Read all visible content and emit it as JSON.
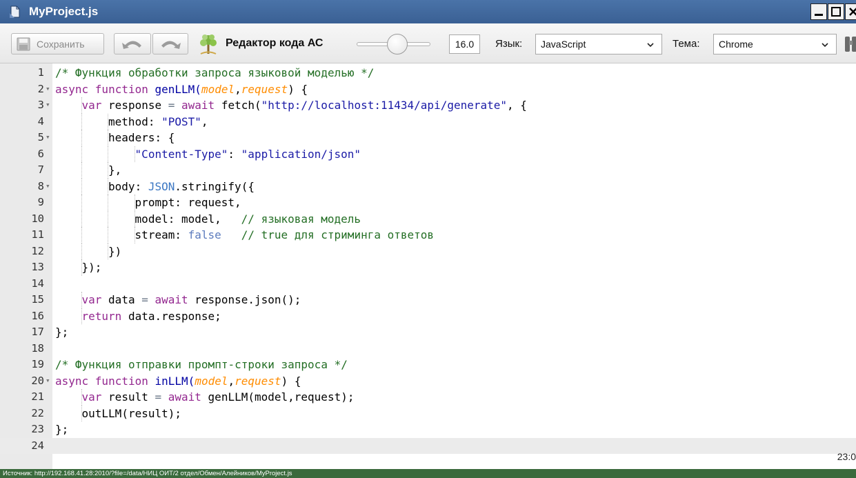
{
  "window": {
    "title": "MyProject.js",
    "icon": "document-icon"
  },
  "toolbar": {
    "save_label": "Сохранить",
    "brand_label": "Редактор кода АС",
    "font_size": "16.0",
    "language_label": "Язык:",
    "language_value": "JavaScript",
    "theme_label": "Тема:",
    "theme_value": "Chrome"
  },
  "editor": {
    "cursor_position": "23:0",
    "lines": [
      {
        "n": "1",
        "fold": "",
        "indent": 0,
        "tokens": [
          {
            "t": "/* Функция обработки запроса языковой моделью */",
            "c": "comment"
          }
        ]
      },
      {
        "n": "2",
        "fold": "▾",
        "indent": 0,
        "tokens": [
          {
            "t": "async ",
            "c": "kw"
          },
          {
            "t": "function ",
            "c": "kw"
          },
          {
            "t": "genLLM",
            "c": "fn"
          },
          {
            "t": "(",
            "c": "fn"
          },
          {
            "t": "model",
            "c": "param"
          },
          {
            "t": ",",
            "c": "def"
          },
          {
            "t": "request",
            "c": "param"
          },
          {
            "t": ") {",
            "c": "def"
          }
        ]
      },
      {
        "n": "3",
        "fold": "▾",
        "indent": 1,
        "tokens": [
          {
            "t": "var ",
            "c": "kw"
          },
          {
            "t": "response ",
            "c": "def"
          },
          {
            "t": "= ",
            "c": "op"
          },
          {
            "t": "await ",
            "c": "kw"
          },
          {
            "t": "fetch(",
            "c": "def"
          },
          {
            "t": "\"http://localhost:11434/api/generate\"",
            "c": "str"
          },
          {
            "t": ", {",
            "c": "def"
          }
        ]
      },
      {
        "n": "4",
        "fold": "",
        "indent": 2,
        "tokens": [
          {
            "t": "method: ",
            "c": "def"
          },
          {
            "t": "\"POST\"",
            "c": "str"
          },
          {
            "t": ",",
            "c": "def"
          }
        ]
      },
      {
        "n": "5",
        "fold": "▾",
        "indent": 2,
        "tokens": [
          {
            "t": "headers: {",
            "c": "def"
          }
        ]
      },
      {
        "n": "6",
        "fold": "",
        "indent": 3,
        "tokens": [
          {
            "t": "\"Content-Type\"",
            "c": "str"
          },
          {
            "t": ": ",
            "c": "def"
          },
          {
            "t": "\"application/json\"",
            "c": "str"
          }
        ]
      },
      {
        "n": "7",
        "fold": "",
        "indent": 2,
        "tokens": [
          {
            "t": "},",
            "c": "def"
          }
        ]
      },
      {
        "n": "8",
        "fold": "▾",
        "indent": 2,
        "tokens": [
          {
            "t": "body: ",
            "c": "def"
          },
          {
            "t": "JSON",
            "c": "builtin"
          },
          {
            "t": ".stringify({",
            "c": "def"
          }
        ]
      },
      {
        "n": "9",
        "fold": "",
        "indent": 3,
        "tokens": [
          {
            "t": "prompt: request,",
            "c": "def"
          }
        ]
      },
      {
        "n": "10",
        "fold": "",
        "indent": 3,
        "tokens": [
          {
            "t": "model: model,   ",
            "c": "def"
          },
          {
            "t": "// языковая модель",
            "c": "comment"
          }
        ]
      },
      {
        "n": "11",
        "fold": "",
        "indent": 3,
        "tokens": [
          {
            "t": "stream: ",
            "c": "def"
          },
          {
            "t": "false",
            "c": "const"
          },
          {
            "t": "   ",
            "c": "def"
          },
          {
            "t": "// true для стриминга ответов",
            "c": "comment"
          }
        ]
      },
      {
        "n": "12",
        "fold": "",
        "indent": 2,
        "tokens": [
          {
            "t": "})",
            "c": "def"
          }
        ]
      },
      {
        "n": "13",
        "fold": "",
        "indent": 1,
        "tokens": [
          {
            "t": "});",
            "c": "def"
          }
        ]
      },
      {
        "n": "14",
        "fold": "",
        "indent": 0,
        "tokens": []
      },
      {
        "n": "15",
        "fold": "",
        "indent": 1,
        "tokens": [
          {
            "t": "var ",
            "c": "kw"
          },
          {
            "t": "data ",
            "c": "def"
          },
          {
            "t": "= ",
            "c": "op"
          },
          {
            "t": "await ",
            "c": "kw"
          },
          {
            "t": "response.json();",
            "c": "def"
          }
        ]
      },
      {
        "n": "16",
        "fold": "",
        "indent": 1,
        "tokens": [
          {
            "t": "return ",
            "c": "kw"
          },
          {
            "t": "data.response;",
            "c": "def"
          }
        ]
      },
      {
        "n": "17",
        "fold": "",
        "indent": 0,
        "tokens": [
          {
            "t": "};",
            "c": "def"
          }
        ]
      },
      {
        "n": "18",
        "fold": "",
        "indent": 0,
        "tokens": []
      },
      {
        "n": "19",
        "fold": "",
        "indent": 0,
        "tokens": [
          {
            "t": "/* Функция отправки промпт-строки запроса */",
            "c": "comment"
          }
        ]
      },
      {
        "n": "20",
        "fold": "▾",
        "indent": 0,
        "tokens": [
          {
            "t": "async ",
            "c": "kw"
          },
          {
            "t": "function ",
            "c": "kw"
          },
          {
            "t": "inLLM",
            "c": "fn"
          },
          {
            "t": "(",
            "c": "fn"
          },
          {
            "t": "model",
            "c": "param"
          },
          {
            "t": ",",
            "c": "def"
          },
          {
            "t": "request",
            "c": "param"
          },
          {
            "t": ") {",
            "c": "def"
          }
        ]
      },
      {
        "n": "21",
        "fold": "",
        "indent": 1,
        "tokens": [
          {
            "t": "var ",
            "c": "kw"
          },
          {
            "t": "result ",
            "c": "def"
          },
          {
            "t": "= ",
            "c": "op"
          },
          {
            "t": "await ",
            "c": "kw"
          },
          {
            "t": "genLLM(model,request);",
            "c": "def"
          }
        ]
      },
      {
        "n": "22",
        "fold": "",
        "indent": 1,
        "tokens": [
          {
            "t": "outLLM(result);",
            "c": "def"
          }
        ]
      },
      {
        "n": "23",
        "fold": "",
        "indent": 0,
        "tokens": [
          {
            "t": "};",
            "c": "def"
          }
        ]
      },
      {
        "n": "24",
        "fold": "",
        "indent": 0,
        "tokens": [],
        "active": true
      }
    ]
  },
  "statusbar": {
    "source": "Источник: http://192.168.41.28:2010/?file=/data/НИЦ ОИТ/2 отдел/Обмен/Алейников/MyProject.js"
  },
  "colors": {
    "titlebar": "#3a6094",
    "comment": "#236e24",
    "keyword": "#93278f",
    "string": "#1a1aa6",
    "parameter": "#ff8c00",
    "statusbar": "#3a6a3c"
  }
}
